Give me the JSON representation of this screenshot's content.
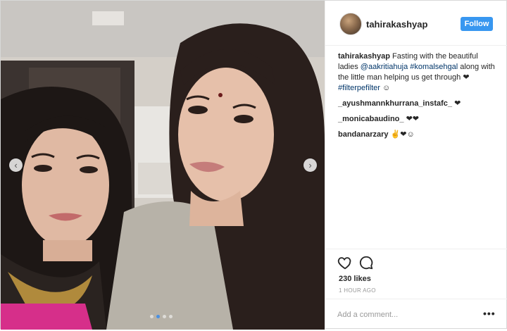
{
  "post": {
    "username": "tahirakashyap",
    "follow_label": "Follow",
    "caption_user": "tahirakashyap",
    "caption_text_1": "Fasting with the beautiful ladies ",
    "mention_1": "@aakritiahuja",
    "hashtag_1": "#komalsehgal",
    "caption_text_2": " along with the little man helping us get through ❤ ",
    "hashtag_2": "#filterpefilter",
    "caption_emoji": " ☺",
    "comments": [
      {
        "user": "_ayushmannkhurrana_instafc_",
        "text": "❤"
      },
      {
        "user": "_monicabaudino_",
        "text": "❤❤"
      },
      {
        "user": "bandanarzary",
        "text": "✌❤☺"
      }
    ],
    "likes": "230 likes",
    "time": "1 HOUR AGO",
    "comment_placeholder": "Add a comment...",
    "more_label": "•••"
  },
  "carousel": {
    "current": 2,
    "total": 4,
    "prev_glyph": "‹",
    "next_glyph": "›"
  },
  "colors": {
    "follow_bg": "#3897f0",
    "link": "#003569",
    "active_dot": "#4a90e2"
  },
  "icons": [
    "heart-icon",
    "comment-icon",
    "chevron-left-icon",
    "chevron-right-icon",
    "more-icon"
  ]
}
